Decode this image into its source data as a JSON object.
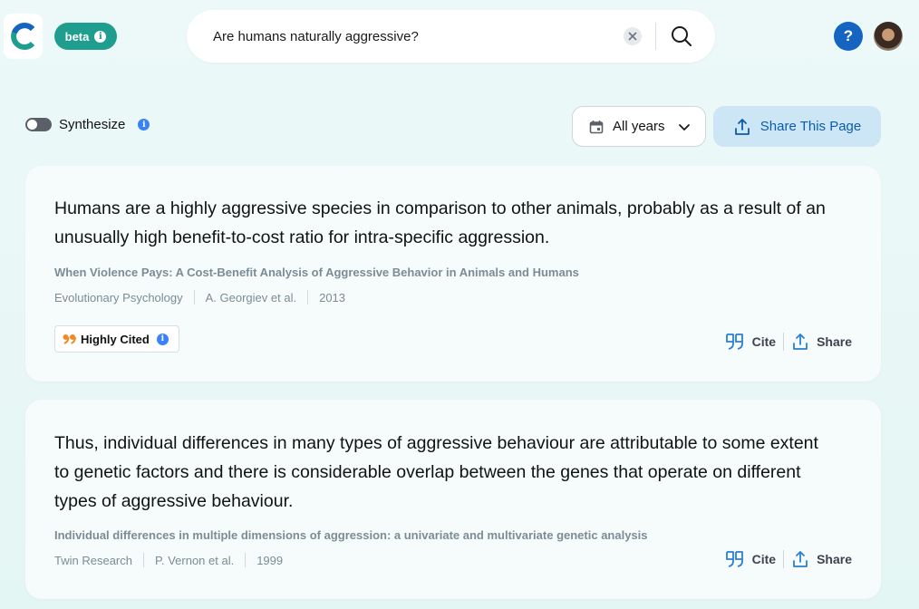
{
  "header": {
    "beta_label": "beta",
    "search": {
      "value": "Are humans naturally aggressive?",
      "placeholder": "Search"
    },
    "help_label": "?"
  },
  "toolbar": {
    "synthesize_label": "Synthesize",
    "synthesize_on": false,
    "years_label": "All years",
    "share_page_label": "Share This Page"
  },
  "results": [
    {
      "finding": "Humans are a highly aggressive species in comparison to other animals, probably as a result of an unusually high benefit-to-cost ratio for intra-specific aggression.",
      "paper_title": "When Violence Pays: A Cost-Benefit Analysis of Aggressive Behavior in Animals and Humans",
      "journal": "Evolutionary Psychology",
      "authors": "A. Georgiev et al.",
      "year": "2013",
      "badge": "Highly Cited",
      "cite_label": "Cite",
      "share_label": "Share"
    },
    {
      "finding": "Thus, individual differences in many types of aggressive behaviour are attributable to some extent to genetic factors and there is considerable overlap between the genes that operate on different types of aggressive behaviour.",
      "paper_title": "Individual differences in multiple dimensions of aggression: a univariate and multivariate genetic analysis",
      "journal": "Twin Research",
      "authors": "P. Vernon et al.",
      "year": "1999",
      "cite_label": "Cite",
      "share_label": "Share"
    }
  ],
  "colors": {
    "brand": "#1f9e8f",
    "help": "#1565c0",
    "share_page_bg": "#cce6f6",
    "meta_text": "#7b8c96"
  },
  "icons": {
    "logo": "consensus-logo-icon",
    "beta_info": "info-icon",
    "clear": "close-icon",
    "search": "search-icon",
    "calendar": "calendar-icon",
    "chevron": "chevron-down-icon",
    "upload": "share-icon",
    "quote": "quote-icon"
  }
}
